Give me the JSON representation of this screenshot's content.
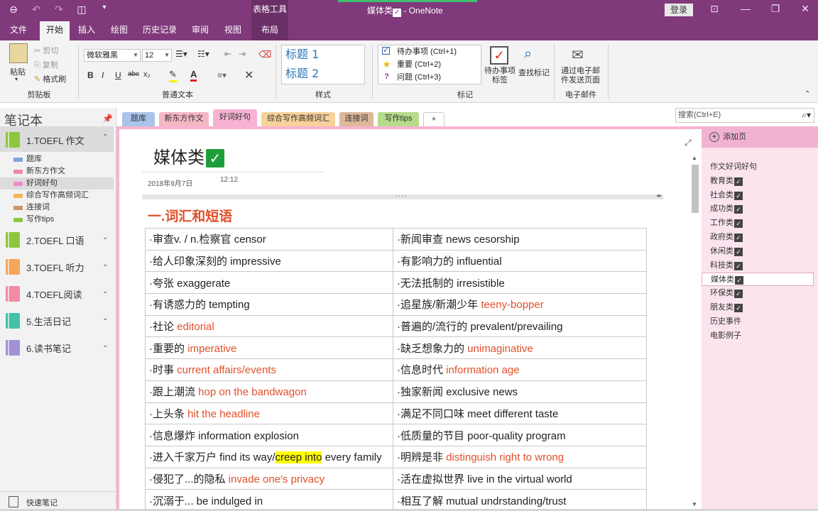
{
  "app": {
    "doc_title": "媒体类",
    "app_sep": " - ",
    "app_name": "OneNote",
    "context_tool": "表格工具",
    "login": "登录",
    "qat": [
      "⊖",
      "↶",
      "↷",
      "◫",
      "▾"
    ],
    "win_controls": [
      "⊡",
      "—",
      "❐",
      "✕"
    ]
  },
  "ribbon_tabs": [
    "文件",
    "开始",
    "插入",
    "绘图",
    "历史记录",
    "审阅",
    "视图",
    "布局"
  ],
  "ribbon": {
    "clipboard": {
      "paste": "粘贴",
      "cut": "剪切",
      "copy": "复制",
      "format_painter": "格式刷",
      "label": "剪贴板"
    },
    "basic_text": {
      "font": "微软雅黑",
      "size": "12",
      "bold": "B",
      "italic": "I",
      "underline": "U",
      "strike": "abc",
      "sub": "x₂",
      "label": "普通文本"
    },
    "styles": {
      "h1": "标题 1",
      "h2": "标题 2",
      "label": "样式"
    },
    "tags": {
      "todo": "待办事项 (Ctrl+1)",
      "important": "重要 (Ctrl+2)",
      "question": "问题 (Ctrl+3)",
      "todo_tag_1": "待办事项",
      "todo_tag_2": "标签",
      "find_tags": "查找标记",
      "label": "标记"
    },
    "email": {
      "line1": "通过电子邮",
      "line2": "件发送页面",
      "label": "电子邮件"
    }
  },
  "notebook_pane": {
    "title": "笔记本",
    "notebooks": [
      {
        "label": "1.TOEFL 作文",
        "color": "#8cc63f"
      },
      {
        "label": "2.TOEFL 口语",
        "color": "#8cc63f"
      },
      {
        "label": "3.TOEFL 听力",
        "color": "#f5a65b"
      },
      {
        "label": "4.TOEFL阅读",
        "color": "#f08ca5"
      },
      {
        "label": "5.生活日记",
        "color": "#46c0a8"
      },
      {
        "label": "6.读书笔记",
        "color": "#a291d6"
      }
    ],
    "sections": [
      {
        "label": "题库",
        "color": "#7ea6dc"
      },
      {
        "label": "新东方作文",
        "color": "#f08ca5"
      },
      {
        "label": "好词好句",
        "color": "#f08cc8"
      },
      {
        "label": "综合写作高频词汇",
        "color": "#f5b45b"
      },
      {
        "label": "连接词",
        "color": "#c8956c"
      },
      {
        "label": "写作tips",
        "color": "#8cc63f"
      }
    ],
    "quick_notes": "快速笔记"
  },
  "section_tabs": [
    {
      "label": "题库",
      "color": "#a9c4ea"
    },
    {
      "label": "新东方作文",
      "color": "#f5b6c6"
    },
    {
      "label": "好词好句",
      "color": "#f6b3d3"
    },
    {
      "label": "综合写作高频词汇",
      "color": "#f8d29a"
    },
    {
      "label": "连接词",
      "color": "#ddb99a"
    },
    {
      "label": "写作tips",
      "color": "#b6dc8a"
    },
    {
      "label": "+",
      "color": "#ffffff"
    }
  ],
  "search": {
    "placeholder": "搜索(Ctrl+E)"
  },
  "page": {
    "title": "媒体类",
    "date": "2018年9月7日",
    "time": "12:12",
    "heading": "一.词汇和短语",
    "rows": [
      [
        {
          "zh": "·审查v. / n.检察官",
          "en": "censor",
          "red": false
        },
        {
          "zh": "·新闻审查",
          "en": "news cesorship",
          "red": false
        }
      ],
      [
        {
          "zh": "·给人印象深刻的",
          "en": "impressive",
          "red": false
        },
        {
          "zh": "·有影响力的",
          "en": "influential",
          "red": false
        }
      ],
      [
        {
          "zh": "·夸张",
          "en": "exaggerate",
          "red": false
        },
        {
          "zh": "·无法抵制的",
          "en": "irresistible",
          "red": false
        }
      ],
      [
        {
          "zh": "·有诱惑力的",
          "en": "tempting",
          "red": false
        },
        {
          "zh": "·追星族/新潮少年",
          "en": "teeny-bopper",
          "red": true
        }
      ],
      [
        {
          "zh": "·社论",
          "en": "editorial",
          "red": true
        },
        {
          "zh": "·普遍的/流行的",
          "en": "prevalent/prevailing",
          "red": false
        }
      ],
      [
        {
          "zh": "·重要的",
          "en": "imperative",
          "red": true
        },
        {
          "zh": "·缺乏想象力的",
          "en": "unimaginative",
          "red": true
        }
      ],
      [
        {
          "zh": "·时事",
          "en": "current affairs/events",
          "red": true
        },
        {
          "zh": "·信息时代",
          "en": "information age",
          "red": true
        }
      ],
      [
        {
          "zh": "·跟上潮流",
          "en": "hop on the bandwagon",
          "red": true
        },
        {
          "zh": "·独家新闻",
          "en": "exclusive news",
          "red": false
        }
      ],
      [
        {
          "zh": "·上头条",
          "en": "hit the headline",
          "red": true
        },
        {
          "zh": "·满足不同口味",
          "en": "meet different taste",
          "red": false
        }
      ],
      [
        {
          "zh": "·信息爆炸",
          "en": "information explosion",
          "red": false
        },
        {
          "zh": "·低质量的节目",
          "en": "poor-quality program",
          "red": false
        }
      ],
      [
        {
          "zh": "·进入千家万户",
          "en_pre": "find its way/",
          "en_hl": "creep into",
          "en_post": " every family"
        },
        {
          "zh": "·明辨是非",
          "en": "distinguish right to wrong",
          "red": true
        }
      ],
      [
        {
          "zh": "·侵犯了...的隐私",
          "en": "invade one's privacy",
          "red": true
        },
        {
          "zh": "·活在虚拟世界",
          "en": "live in the virtual world",
          "red": false
        }
      ],
      [
        {
          "zh": "·沉溺于...",
          "en": "be indulged in",
          "red": false
        },
        {
          "zh": "·相互了解",
          "en": "mutual undrstanding/trust",
          "red": false
        }
      ]
    ]
  },
  "page_pane": {
    "add_page": "添加页",
    "pages": [
      {
        "label": "作文好词好句",
        "check": false
      },
      {
        "label": "教育类",
        "check": true
      },
      {
        "label": "社会类",
        "check": true
      },
      {
        "label": "成功类",
        "check": true
      },
      {
        "label": "工作类",
        "check": true
      },
      {
        "label": "政府类",
        "check": true
      },
      {
        "label": "休闲类",
        "check": true
      },
      {
        "label": "科技类",
        "check": true
      },
      {
        "label": "媒体类",
        "check": true,
        "active": true
      },
      {
        "label": "环保类",
        "check": true
      },
      {
        "label": "朋友类",
        "check": true
      },
      {
        "label": "历史事件",
        "check": false
      },
      {
        "label": "电影例子",
        "check": false
      }
    ]
  },
  "colors": {
    "brand": "#80397b",
    "accent_red": "#e0502b",
    "highlight": "#ffff00",
    "check_green": "#1e9e3a"
  }
}
